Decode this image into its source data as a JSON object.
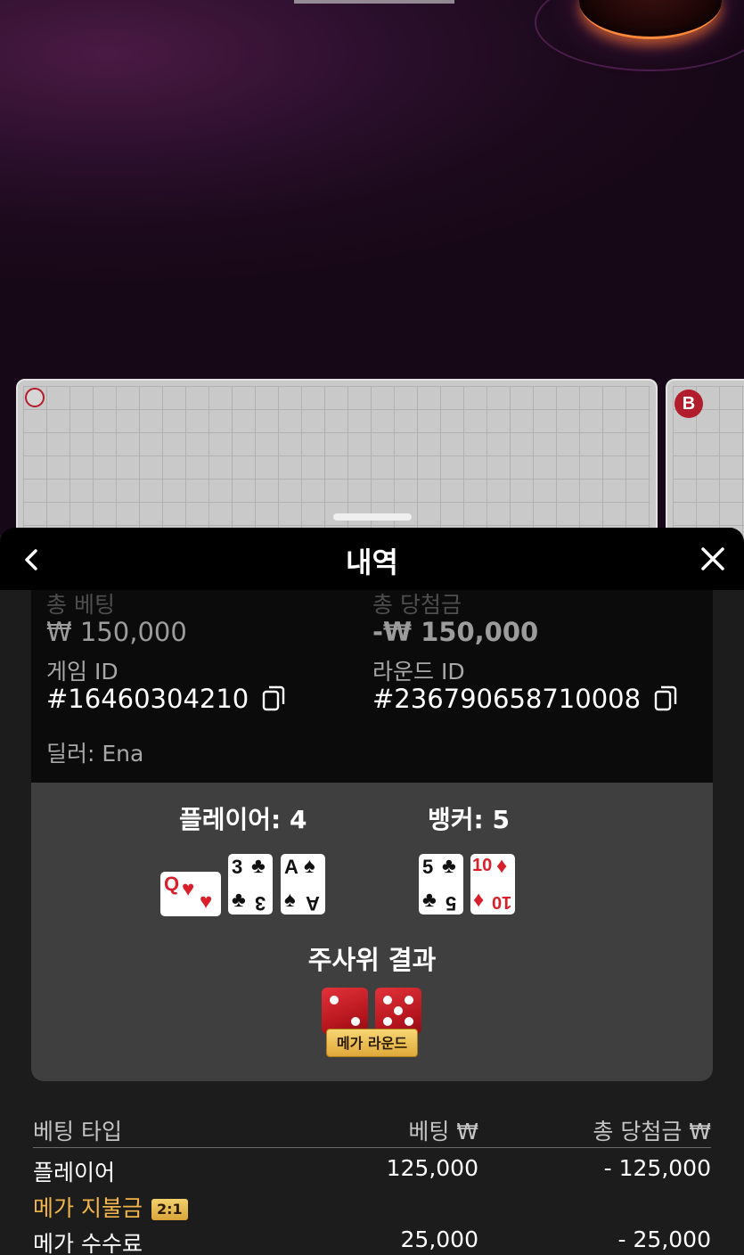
{
  "header": {
    "title": "내역"
  },
  "roadmap": {
    "player_marker": "",
    "banker_marker": "B"
  },
  "summary": {
    "total_bet_label": "총 베팅",
    "total_bet_value": "₩ 150,000",
    "total_win_label": "총 당첨금",
    "total_win_value": "-₩ 150,000",
    "game_id_label": "게임 ID",
    "game_id_value": "#16460304210",
    "round_id_label": "라운드 ID",
    "round_id_value": "#236790658710008",
    "dealer_text": "딜러: Ena"
  },
  "result": {
    "player_label": "플레이어: 4",
    "banker_label": "뱅커: 5",
    "player_cards": [
      {
        "rank": "Q",
        "suit": "♥",
        "color": "red",
        "orientation": "sideways"
      },
      {
        "rank": "3",
        "suit": "♣",
        "color": "black"
      },
      {
        "rank": "A",
        "suit": "♠",
        "color": "black"
      }
    ],
    "banker_cards": [
      {
        "rank": "5",
        "suit": "♣",
        "color": "black"
      },
      {
        "rank": "10",
        "suit": "♦",
        "color": "red"
      }
    ],
    "dice_title": "주사위 결과",
    "dice": [
      2,
      5
    ],
    "mega_round_label": "메가 라운드"
  },
  "bets_table": {
    "headers": [
      "베팅 타입",
      "베팅 ₩",
      "총 당첨금 ₩"
    ],
    "rows": [
      {
        "type": "플레이어",
        "bet": "125,000",
        "win": "- 125,000"
      },
      {
        "type": "메가 지불금",
        "badge": "2:1",
        "bet": "",
        "win": ""
      },
      {
        "type": "메가 수수료",
        "bet": "25,000",
        "win": "- 25,000"
      }
    ]
  },
  "colors": {
    "accent_gold": "#f2b54a",
    "card_red": "#d91f2a",
    "banker_red": "#b11d2a"
  },
  "icons": [
    "chevron-left-icon",
    "close-icon",
    "copy-icon"
  ]
}
